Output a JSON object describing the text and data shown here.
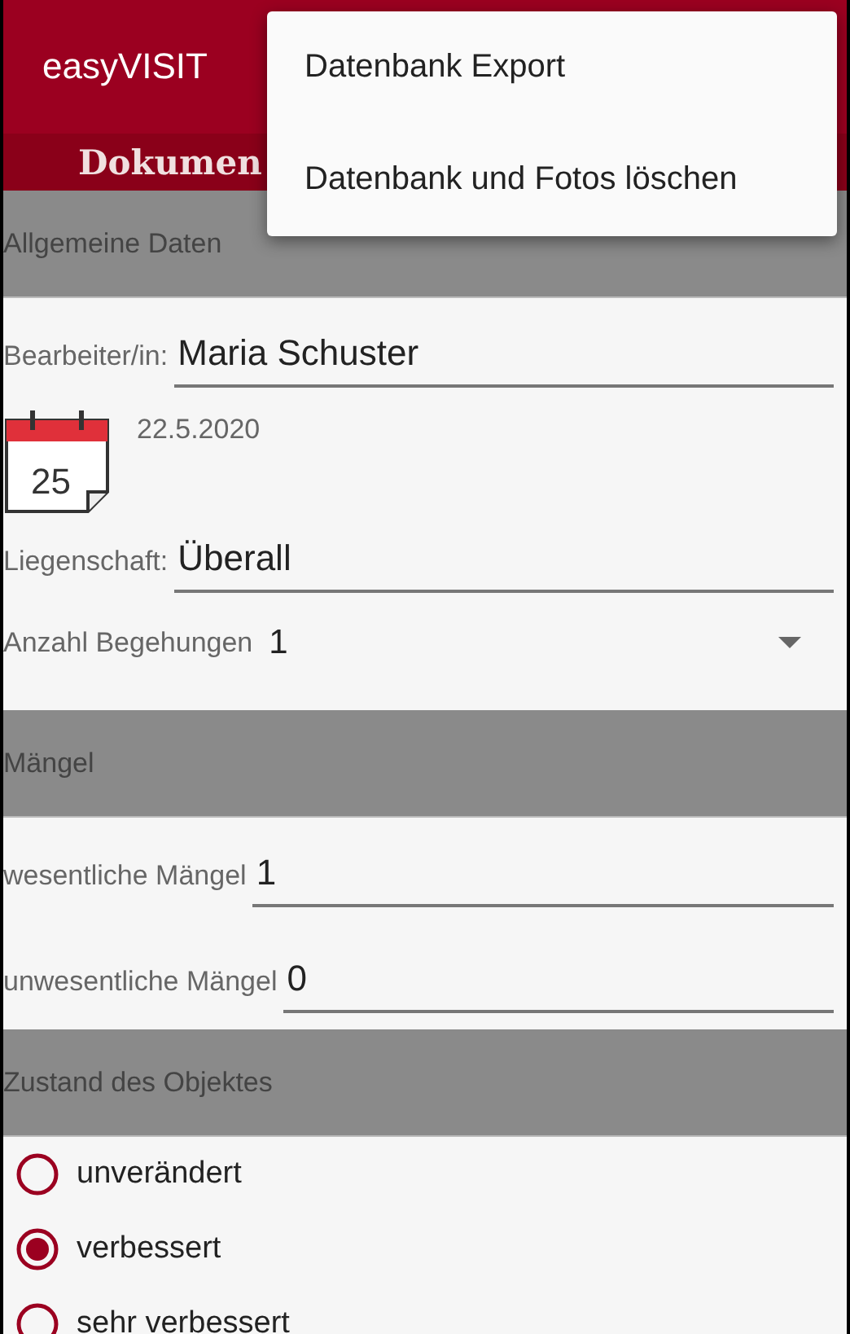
{
  "app_bar": {
    "title": "easyVISIT",
    "subtitle": "Dokumen"
  },
  "menu": {
    "items": [
      {
        "label": "Datenbank Export"
      },
      {
        "label": "Datenbank und Fotos löschen"
      }
    ]
  },
  "sections": [
    {
      "title": "Allgemeine Daten",
      "fields": [
        {
          "kind": "text",
          "label": "Bearbeiter/in:",
          "value": "Maria Schuster"
        },
        {
          "kind": "date",
          "value": "22.5.2020",
          "icon_text": "25"
        },
        {
          "kind": "text",
          "label": "Liegenschaft:",
          "value": "Überall"
        },
        {
          "kind": "dropdown",
          "label": "Anzahl Begehungen",
          "value": "1"
        }
      ]
    },
    {
      "title": "Mängel",
      "fields": [
        {
          "kind": "text",
          "label": "wesentliche Mängel",
          "value": "1"
        },
        {
          "kind": "text",
          "label": "unwesentliche Mängel",
          "value": "0"
        }
      ]
    },
    {
      "title": "Zustand des Objektes",
      "fields": [
        {
          "kind": "radio",
          "label": "unverändert",
          "selected": false
        },
        {
          "kind": "radio",
          "label": "verbessert",
          "selected": true
        },
        {
          "kind": "radio",
          "label": "sehr verbessert",
          "selected": false
        }
      ]
    }
  ]
}
